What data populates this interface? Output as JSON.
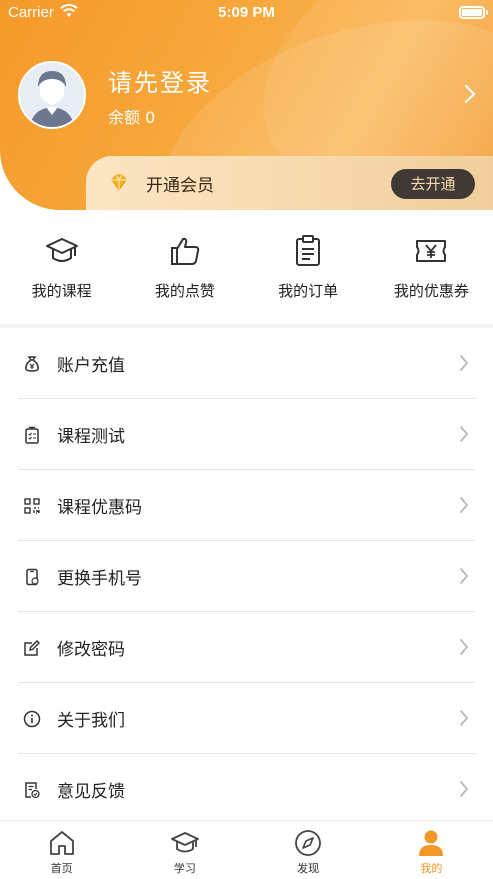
{
  "status_bar": {
    "carrier": "Carrier",
    "time": "5:09 PM"
  },
  "profile": {
    "title": "请先登录",
    "balance": "余额 0"
  },
  "vip": {
    "label": "开通会员",
    "button": "去开通"
  },
  "quick_actions": [
    {
      "label": "我的课程",
      "icon": "graduation-cap-icon"
    },
    {
      "label": "我的点赞",
      "icon": "thumbs-up-icon"
    },
    {
      "label": "我的订单",
      "icon": "order-clipboard-icon"
    },
    {
      "label": "我的优惠券",
      "icon": "yuan-coupon-icon"
    }
  ],
  "menu": [
    {
      "label": "账户充值",
      "icon": "money-bag-icon"
    },
    {
      "label": "课程测试",
      "icon": "test-clipboard-icon"
    },
    {
      "label": "课程优惠码",
      "icon": "qr-code-icon"
    },
    {
      "label": "更换手机号",
      "icon": "phone-icon"
    },
    {
      "label": "修改密码",
      "icon": "edit-icon"
    },
    {
      "label": "关于我们",
      "icon": "info-icon"
    },
    {
      "label": "意见反馈",
      "icon": "feedback-icon"
    }
  ],
  "tabs": [
    {
      "label": "首页",
      "icon": "home-icon",
      "active": false
    },
    {
      "label": "学习",
      "icon": "study-cap-icon",
      "active": false
    },
    {
      "label": "发现",
      "icon": "compass-icon",
      "active": false
    },
    {
      "label": "我的",
      "icon": "person-icon",
      "active": true
    }
  ],
  "colors": {
    "accent": "#f39627",
    "vip_button_bg": "#3f3a35",
    "vip_text": "#f6d8ab"
  }
}
